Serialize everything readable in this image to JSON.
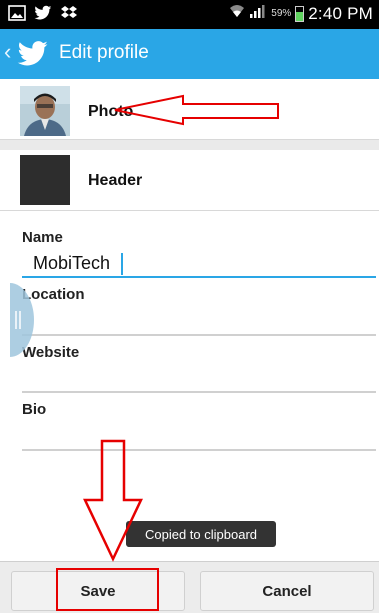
{
  "status_bar": {
    "battery_percent": "59%",
    "time": "2:40 PM",
    "battery_level": 0.59,
    "icons": [
      "image-icon",
      "twitter-icon",
      "dropbox-icon",
      "wifi-icon",
      "signal-icon"
    ]
  },
  "action_bar": {
    "title": "Edit profile",
    "color": "#2aa6e6"
  },
  "profile": {
    "photo_label": "Photo",
    "header_label": "Header"
  },
  "fields": {
    "name_label": "Name",
    "name_value": "MobiTech",
    "location_label": "Location",
    "location_value": "",
    "website_label": "Website",
    "website_value": "",
    "bio_label": "Bio",
    "bio_value": ""
  },
  "toast": {
    "text": "Copied to clipboard"
  },
  "buttons": {
    "save": "Save",
    "cancel": "Cancel"
  },
  "annotation_color": "#e60000"
}
